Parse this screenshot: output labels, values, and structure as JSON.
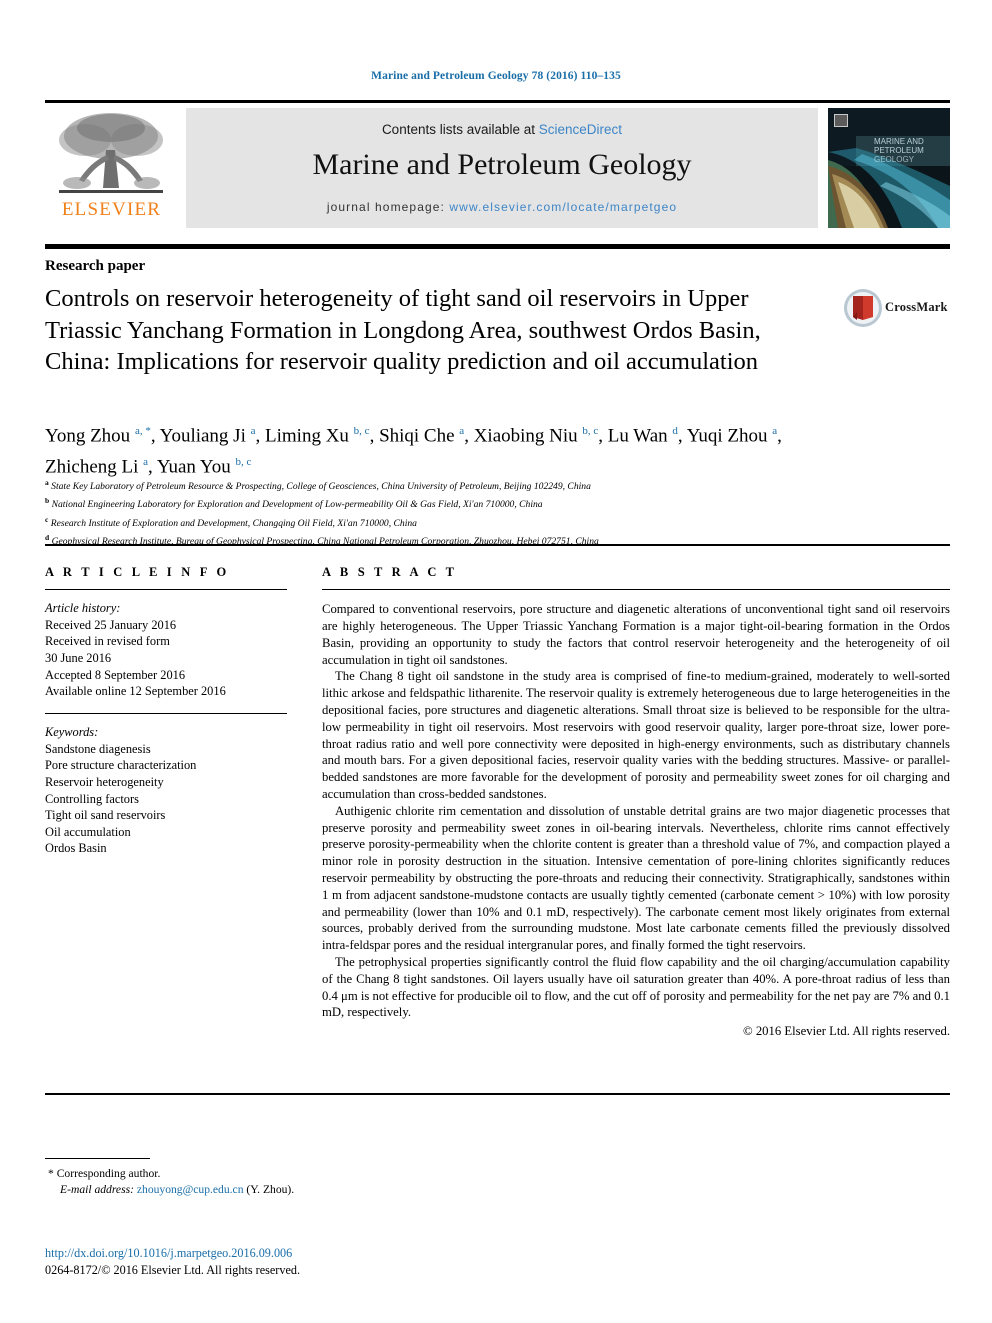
{
  "running_head": "Marine and Petroleum Geology 78 (2016) 110–135",
  "masthead": {
    "publisher_name": "ELSEVIER",
    "publisher_logo_icon": "elsevier-tree-icon",
    "contents_prefix": "Contents lists available at ",
    "contents_link": "ScienceDirect",
    "journal_title": "Marine and Petroleum Geology",
    "homepage_prefix": "journal homepage: ",
    "homepage_url": "www.elsevier.com/locate/marpetgeo",
    "cover_alt": "journal-cover-thumbnail"
  },
  "article": {
    "type": "Research paper",
    "title": "Controls on reservoir heterogeneity of tight sand oil reservoirs in Upper Triassic Yanchang Formation in Longdong Area, southwest Ordos Basin, China: Implications for reservoir quality prediction and oil accumulation",
    "crossmark_label": "CrossMark"
  },
  "authors": [
    {
      "name": "Yong Zhou",
      "marks": "a, *",
      "sep": ", "
    },
    {
      "name": "Youliang Ji",
      "marks": "a",
      "sep": ", "
    },
    {
      "name": "Liming Xu",
      "marks": "b, c",
      "sep": ", "
    },
    {
      "name": "Shiqi Che",
      "marks": "a",
      "sep": ", "
    },
    {
      "name": "Xiaobing Niu",
      "marks": "b, c",
      "sep": ", "
    },
    {
      "name": "Lu Wan",
      "marks": "d",
      "sep": ", "
    },
    {
      "name": "Yuqi Zhou",
      "marks": "a",
      "sep": ", "
    },
    {
      "name": "Zhicheng Li",
      "marks": "a",
      "sep": ", "
    },
    {
      "name": "Yuan You",
      "marks": "b, c",
      "sep": ""
    }
  ],
  "affiliations": [
    {
      "mark": "a",
      "text": "State Key Laboratory of Petroleum Resource & Prospecting, College of Geosciences, China University of Petroleum, Beijing 102249, China"
    },
    {
      "mark": "b",
      "text": "National Engineering Laboratory for Exploration and Development of Low-permeability Oil & Gas Field, Xi'an 710000, China"
    },
    {
      "mark": "c",
      "text": "Research Institute of Exploration and Development, Changqing Oil Field, Xi'an 710000, China"
    },
    {
      "mark": "d",
      "text": "Geophysical Research Institute, Bureau of Geophysical Prospecting, China National Petroleum Corporation, Zhuozhou, Hebei 072751, China"
    }
  ],
  "article_info": {
    "heading": "A R T I C L E   I N F O",
    "history_label": "Article history:",
    "history": [
      "Received 25 January 2016",
      "Received in revised form",
      "30 June 2016",
      "Accepted 8 September 2016",
      "Available online 12 September 2016"
    ],
    "keywords_label": "Keywords:",
    "keywords": [
      "Sandstone diagenesis",
      "Pore structure characterization",
      "Reservoir heterogeneity",
      "Controlling factors",
      "Tight oil sand reservoirs",
      "Oil accumulation",
      "Ordos Basin"
    ]
  },
  "abstract": {
    "heading": "A B S T R A C T",
    "paragraphs": [
      "Compared to conventional reservoirs, pore structure and diagenetic alterations of unconventional tight sand oil reservoirs are highly heterogeneous. The Upper Triassic Yanchang Formation is a major tight-oil-bearing formation in the Ordos Basin, providing an opportunity to study the factors that control reservoir heterogeneity and the heterogeneity of oil accumulation in tight oil sandstones.",
      "The Chang 8 tight oil sandstone in the study area is comprised of fine-to medium-grained, moderately to well-sorted lithic arkose and feldspathic litharenite. The reservoir quality is extremely heterogeneous due to large heterogeneities in the depositional facies, pore structures and diagenetic alterations. Small throat size is believed to be responsible for the ultra-low permeability in tight oil reservoirs. Most reservoirs with good reservoir quality, larger pore-throat size, lower pore-throat radius ratio and well pore connectivity were deposited in high-energy environments, such as distributary channels and mouth bars. For a given depositional facies, reservoir quality varies with the bedding structures. Massive- or parallel-bedded sandstones are more favorable for the development of porosity and permeability sweet zones for oil charging and accumulation than cross-bedded sandstones.",
      "Authigenic chlorite rim cementation and dissolution of unstable detrital grains are two major diagenetic processes that preserve porosity and permeability sweet zones in oil-bearing intervals. Nevertheless, chlorite rims cannot effectively preserve porosity-permeability when the chlorite content is greater than a threshold value of 7%, and compaction played a minor role in porosity destruction in the situation. Intensive cementation of pore-lining chlorites significantly reduces reservoir permeability by obstructing the pore-throats and reducing their connectivity. Stratigraphically, sandstones within 1 m from adjacent sandstone-mudstone contacts are usually tightly cemented (carbonate cement > 10%) with low porosity and permeability (lower than 10% and 0.1 mD, respectively). The carbonate cement most likely originates from external sources, probably derived from the surrounding mudstone. Most late carbonate cements filled the previously dissolved intra-feldspar pores and the residual intergranular pores, and finally formed the tight reservoirs.",
      "The petrophysical properties significantly control the fluid flow capability and the oil charging/accumulation capability of the Chang 8 tight sandstones. Oil layers usually have oil saturation greater than 40%. A pore-throat radius of less than 0.4 μm is not effective for producible oil to flow, and the cut off of porosity and permeability for the net pay are 7% and 0.1 mD, respectively."
    ],
    "copyright": "© 2016 Elsevier Ltd. All rights reserved."
  },
  "footer": {
    "corresponding_marker": "*",
    "corresponding_label": "Corresponding author.",
    "email_label": "E-mail address:",
    "email": "zhouyong@cup.edu.cn",
    "email_suffix": "(Y. Zhou).",
    "doi": "http://dx.doi.org/10.1016/j.marpetgeo.2016.09.006",
    "issn_line": "0264-8172/© 2016 Elsevier Ltd. All rights reserved."
  },
  "colors": {
    "link_blue": "#1a6ea8",
    "sciencedirect_blue": "#3d85c6",
    "elsevier_orange": "#f0811a",
    "banner_gray": "#e4e4e4"
  }
}
